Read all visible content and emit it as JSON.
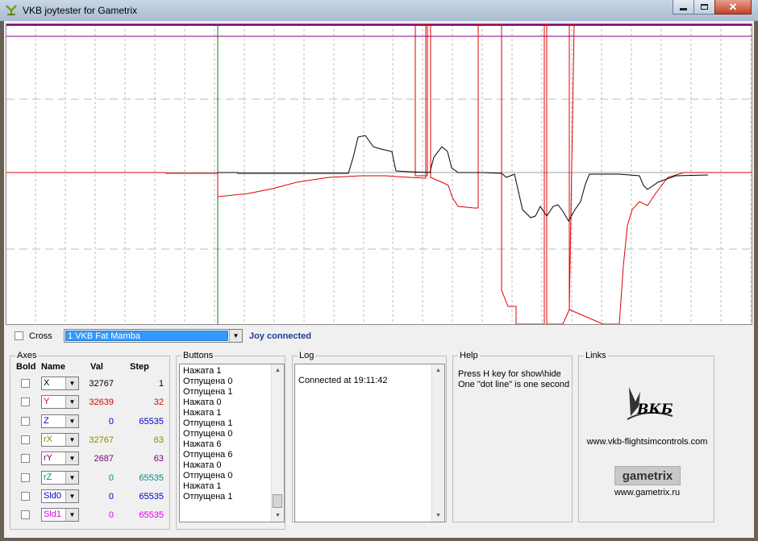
{
  "window": {
    "title": "VKB joytester for Gametrix"
  },
  "graph": {
    "x_grid_count": 25,
    "series_colors": {
      "black": "#000000",
      "red": "#e00000",
      "purple": "#800080",
      "green": "#008000",
      "gray": "#a0a0a0"
    }
  },
  "controls": {
    "cross_label": "Cross",
    "device_selected": "1 VKB Fat Mamba",
    "status": "Joy connected"
  },
  "axes": {
    "group_label": "Axes",
    "headers": {
      "bold": "Bold",
      "name": "Name",
      "val": "Val",
      "step": "Step"
    },
    "rows": [
      {
        "name": "X",
        "val": "32767",
        "step": "1",
        "color": "#000000"
      },
      {
        "name": "Y",
        "val": "32639",
        "step": "32",
        "color": "#e00000"
      },
      {
        "name": "Z",
        "val": "0",
        "step": "65535",
        "color": "#0000c0"
      },
      {
        "name": "rX",
        "val": "32767",
        "step": "63",
        "color": "#8a8a00"
      },
      {
        "name": "rY",
        "val": "2687",
        "step": "63",
        "color": "#800080"
      },
      {
        "name": "rZ",
        "val": "0",
        "step": "65535",
        "color": "#008b8b"
      },
      {
        "name": "Sld0",
        "val": "0",
        "step": "65535",
        "color": "#0000c0"
      },
      {
        "name": "Sld1",
        "val": "0",
        "step": "65535",
        "color": "#e000e0"
      }
    ]
  },
  "buttons": {
    "group_label": "Buttons",
    "items": [
      "Нажата 1",
      "Отпущена 0",
      "Отпущена 1",
      "Нажата 0",
      "Нажата 1",
      "Отпущена 1",
      "Отпущена 0",
      "Нажата 6",
      "Отпущена 6",
      "Нажата 0",
      "Отпущена 0",
      "Нажата 1",
      "Отпущена 1"
    ]
  },
  "log": {
    "group_label": "Log",
    "text": "Connected at 19:11:42"
  },
  "help": {
    "group_label": "Help",
    "line1": "Press H key for show\\hide",
    "line2": "One \"dot line\" is one second"
  },
  "links": {
    "group_label": "Links",
    "vkb_logo_text": "ВКБ",
    "vkb_url": "www.vkb-flightsimcontrols.com",
    "gametrix_logo_text": "gametrix",
    "gametrix_url": "www.gametrix.ru"
  }
}
